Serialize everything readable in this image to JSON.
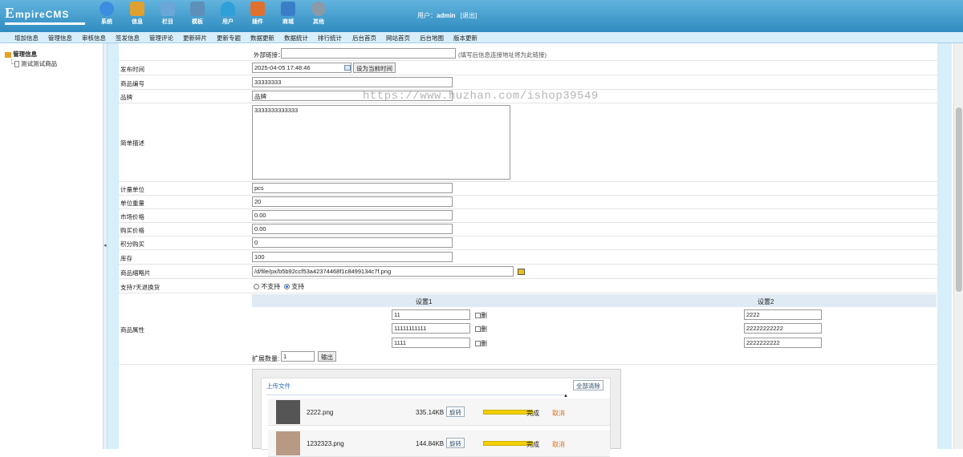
{
  "header": {
    "logo_text": "EmpireCMS",
    "nav": [
      {
        "label": "系统",
        "icon": "globe-icon",
        "color": "#3a8de0"
      },
      {
        "label": "信息",
        "icon": "edit-icon",
        "color": "#e0a030"
      },
      {
        "label": "栏目",
        "icon": "folder-icon",
        "color": "#6aa6d8"
      },
      {
        "label": "模板",
        "icon": "template-icon",
        "color": "#5d8fb8"
      },
      {
        "label": "用户",
        "icon": "user-icon",
        "color": "#2fa0d8"
      },
      {
        "label": "插件",
        "icon": "tools-icon",
        "color": "#e07030"
      },
      {
        "label": "商城",
        "icon": "shop-icon",
        "color": "#3a7ec8"
      },
      {
        "label": "其他",
        "icon": "gear-icon",
        "color": "#8a9aa8"
      }
    ],
    "user_label": "用户：",
    "user_name": "admin",
    "logout": "[退出]"
  },
  "menu": [
    "增加信息",
    "管理信息",
    "审核信息",
    "签发信息",
    "管理评论",
    "更新碎片",
    "更新专题",
    "数据更新",
    "数据统计",
    "排行统计",
    "后台首页",
    "网站首页",
    "后台地图",
    "版本更新"
  ],
  "tree": {
    "root": "管理信息",
    "child": "测试测试商品"
  },
  "watermark": "https://www.huzhan.com/ishop39549",
  "form": {
    "external_link_label": "外部链接：",
    "external_link_note": "(填写后信息连接地址将为此链接)",
    "publish_time_label": "发布时间",
    "publish_time_value": "2025-04-05 17:48:46",
    "set_now_button": "设为当前时间",
    "product_no_label": "商品编号",
    "product_no_value": "33333333",
    "brand_label": "品牌",
    "brand_value": "品牌",
    "desc_label": "简单描述",
    "desc_value": "3333333333333",
    "unit_label": "计量单位",
    "unit_value": "pcs",
    "weight_label": "单位重量",
    "weight_value": "20",
    "market_price_label": "市场价格",
    "market_price_value": "0.00",
    "buy_price_label": "购买价格",
    "buy_price_value": "0.00",
    "points_label": "积分购买",
    "points_value": "0",
    "stock_label": "库存",
    "stock_value": "100",
    "thumb_label": "商品缩略片",
    "thumb_value": "/d/file/px/b5b92ccf53a42374468f1c8499134c7f.png",
    "return_label": "支持7天退换货",
    "return_no": "不支持",
    "return_yes": "支持",
    "attr_label": "商品属性",
    "attr_header1": "设置1",
    "attr_header2": "设置2",
    "attr_delete": "删",
    "attr_rows": [
      {
        "v1": "11",
        "v2": "2222"
      },
      {
        "v1": "11111111111",
        "v2": "22222222222"
      },
      {
        "v1": "1111",
        "v2": "2222222222"
      }
    ],
    "expand_label": "扩展数量:",
    "expand_value": "1",
    "expand_button": "输出"
  },
  "upload": {
    "title": "上传文件",
    "clear_all": "全部清除",
    "files": [
      {
        "name": "2222.png",
        "size": "335.14KB",
        "rotate": "旋转",
        "status": "完成",
        "cancel": "取消",
        "progress": 1.0
      },
      {
        "name": "1232323.png",
        "size": "144.84KB",
        "rotate": "旋转",
        "status": "完成",
        "cancel": "取消",
        "progress": 1.0
      }
    ]
  }
}
